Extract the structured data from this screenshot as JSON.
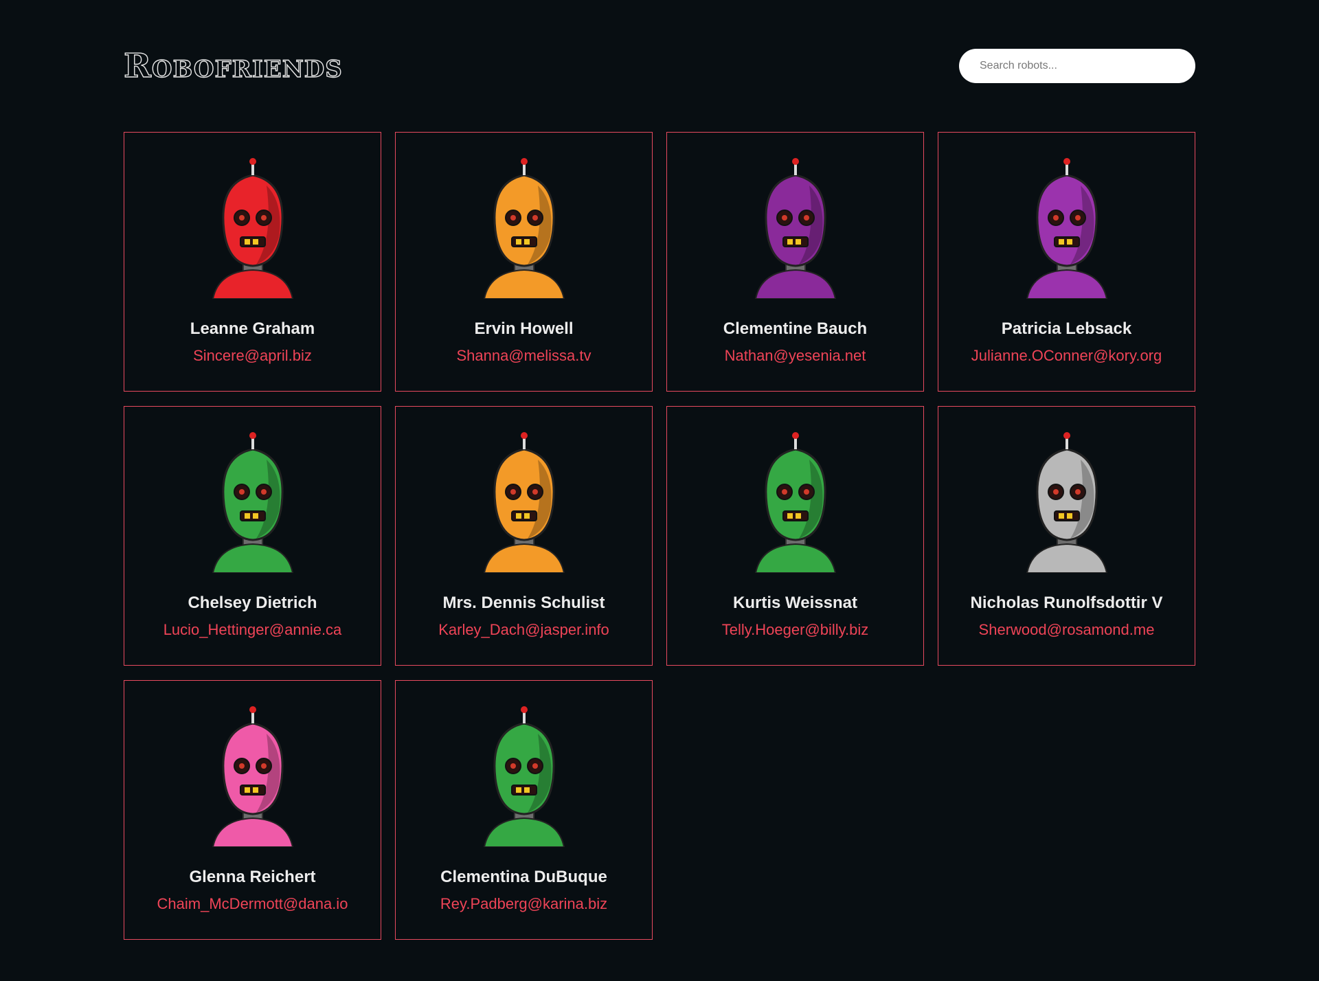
{
  "header": {
    "title": "Robofriends",
    "search_placeholder": "Search robots..."
  },
  "colors": {
    "background": "#080e12",
    "card_border": "#e84a5f",
    "email_text": "#ef4457",
    "name_text": "#ededed"
  },
  "robots": [
    {
      "name": "Leanne Graham",
      "email": "Sincere@april.biz",
      "color": "#e8232a",
      "icon": "red-robot-avatar-icon"
    },
    {
      "name": "Ervin Howell",
      "email": "Shanna@melissa.tv",
      "color": "#f39a28",
      "icon": "orange-robot-avatar-icon"
    },
    {
      "name": "Clementine Bauch",
      "email": "Nathan@yesenia.net",
      "color": "#8a2a9a",
      "icon": "purple-robot-avatar-icon"
    },
    {
      "name": "Patricia Lebsack",
      "email": "Julianne.OConner@kory.org",
      "color": "#9b33ad",
      "icon": "purple-robot-avatar-icon"
    },
    {
      "name": "Chelsey Dietrich",
      "email": "Lucio_Hettinger@annie.ca",
      "color": "#35a844",
      "icon": "green-robot-avatar-icon"
    },
    {
      "name": "Mrs. Dennis Schulist",
      "email": "Karley_Dach@jasper.info",
      "color": "#f39a28",
      "icon": "orange-robot-avatar-icon"
    },
    {
      "name": "Kurtis Weissnat",
      "email": "Telly.Hoeger@billy.biz",
      "color": "#35a844",
      "icon": "green-robot-avatar-icon"
    },
    {
      "name": "Nicholas Runolfsdottir V",
      "email": "Sherwood@rosamond.me",
      "color": "#b8b8b8",
      "icon": "silver-robot-avatar-icon"
    },
    {
      "name": "Glenna Reichert",
      "email": "Chaim_McDermott@dana.io",
      "color": "#ef5aa8",
      "icon": "pink-robot-avatar-icon"
    },
    {
      "name": "Clementina DuBuque",
      "email": "Rey.Padberg@karina.biz",
      "color": "#35a844",
      "icon": "green-robot-avatar-icon"
    }
  ]
}
